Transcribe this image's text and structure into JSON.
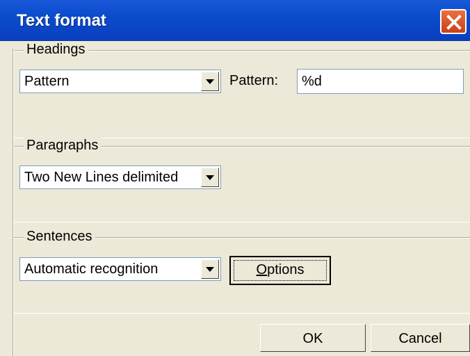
{
  "window": {
    "title": "Text format",
    "close_icon": "close-icon"
  },
  "headings": {
    "group_label": "Headings",
    "combo_value": "Pattern",
    "pattern_label": "Pattern:",
    "pattern_value": "%d"
  },
  "paragraphs": {
    "group_label": "Paragraphs",
    "combo_value": "Two New Lines delimited"
  },
  "sentences": {
    "group_label": "Sentences",
    "combo_value": "Automatic recognition",
    "options_label_underlined": "O",
    "options_label_rest": "ptions"
  },
  "footer": {
    "ok_label": "OK",
    "cancel_label": "Cancel"
  },
  "colors": {
    "titlebar": "#0a4ccc",
    "dialog_bg": "#ece9d8",
    "close_button": "#d9572b"
  }
}
